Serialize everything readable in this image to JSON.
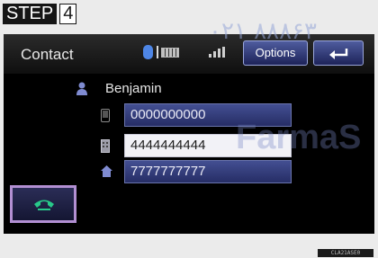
{
  "step": {
    "word": "STEP",
    "number": "4"
  },
  "watermark": {
    "digits": "۰۲۱ ۸۸۸۶۳",
    "text": "FarmaS"
  },
  "header": {
    "title": "Contact",
    "options_label": "Options"
  },
  "contact": {
    "name": "Benjamin",
    "phones": [
      {
        "number": "0000000000",
        "selected": false
      },
      {
        "number": "4444444444",
        "selected": true
      },
      {
        "number": "7777777777",
        "selected": false
      }
    ]
  },
  "footer": {
    "code": "CLA21ASE0"
  },
  "colors": {
    "button_gradient_top": "#4f5c9e",
    "button_gradient_bottom": "#1d2359",
    "selected_field": "#f2f2f7",
    "call_button_border": "#b28fd2",
    "call_icon": "#28c98a",
    "bluetooth": "#4e86e6"
  }
}
